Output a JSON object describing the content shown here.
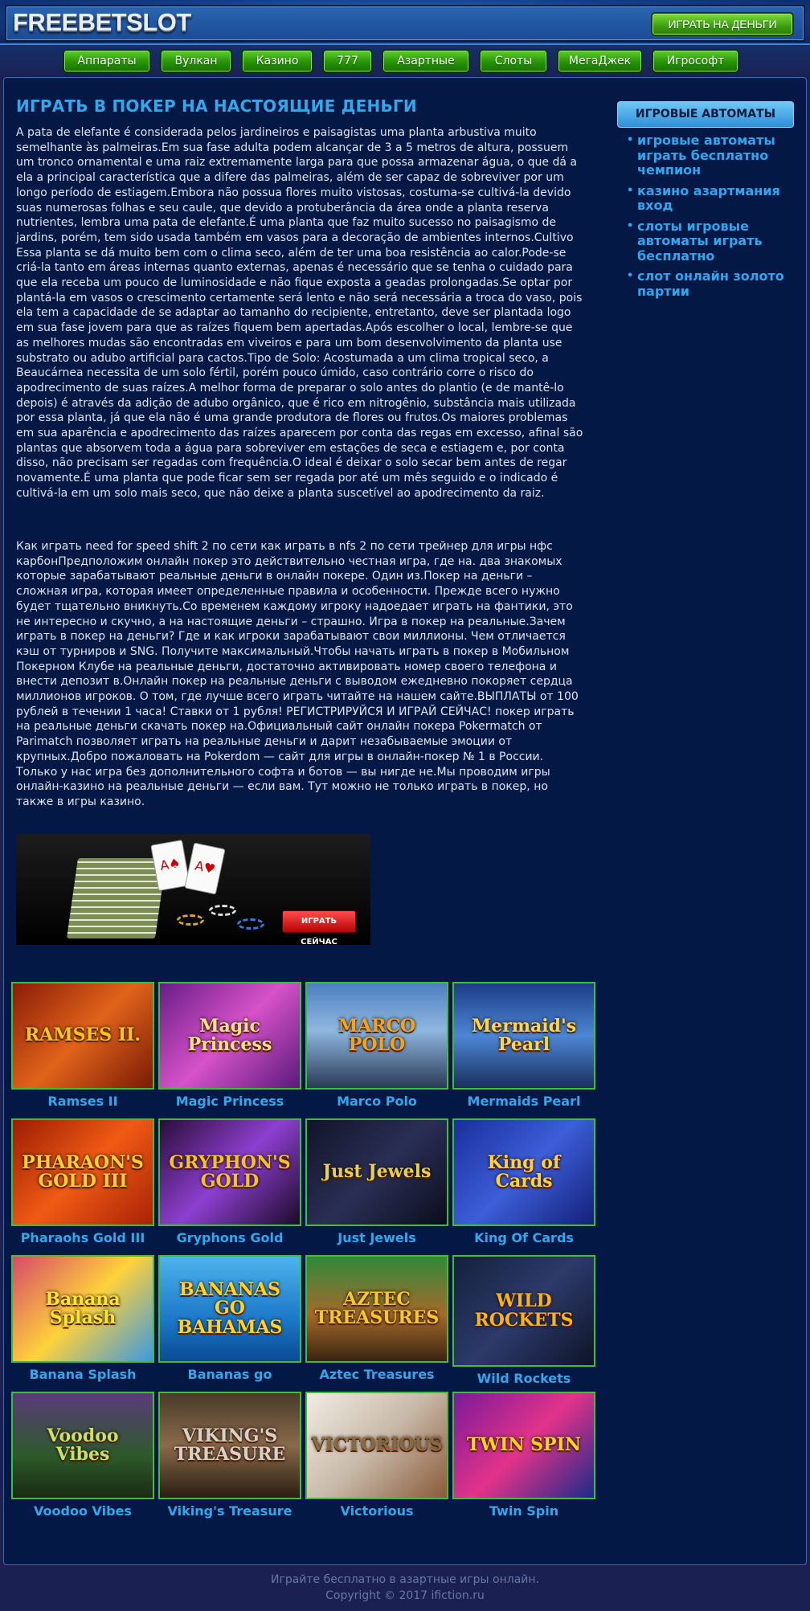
{
  "header": {
    "logo": "FREEBETSLOT",
    "cta": "ИГРАТЬ НА ДЕНЬГИ"
  },
  "nav": [
    "Аппараты",
    "Вулкан",
    "Казино",
    "777",
    "Азартные",
    "Слоты",
    "МегаДжек",
    "Игрософт"
  ],
  "main": {
    "title": "ИГРАТЬ В ПОКЕР НА НАСТОЯЩИЕ ДЕНЬГИ",
    "paragraph1": "A pata de elefante é considerada pelos jardineiros e paisagistas uma planta arbustiva muito semelhante às palmeiras.Em sua fase adulta podem alcançar de 3 a 5 metros de altura, possuem um tronco ornamental e uma raiz extremamente larga para que possa armazenar água, o que dá a ela a principal característica que a difere das palmeiras, além de ser capaz de sobreviver por um longo período de estiagem.Embora não possua flores muito vistosas, costuma-se cultivá-la devido suas numerosas folhas e seu caule, que devido a protuberância da área onde a planta reserva nutrientes, lembra uma pata de elefante.É uma planta que faz muito sucesso no paisagismo de jardins, porém, tem sido usada também em vasos para a decoração de ambientes internos.Cultivo Essa planta se dá muito bem com o clima seco, além de ter uma boa resistência ao calor.Pode-se criá-la tanto em áreas internas quanto externas, apenas é necessário que se tenha o cuidado para que ela receba um pouco de luminosidade e não fique exposta a geadas prolongadas.Se optar por plantá-la em vasos o crescimento certamente será lento e não será necessária a troca do vaso, pois ela tem a capacidade de se adaptar ao tamanho do recipiente, entretanto, deve ser plantada logo em sua fase jovem para que as raízes fiquem bem apertadas.Após escolher o local, lembre-se que as melhores mudas são encontradas em viveiros e para um bom desenvolvimento da planta use substrato ou adubo artificial para cactos.Tipo de Solo: Acostumada a um clima tropical seco, a Beaucárnea necessita de um solo fértil, porém pouco úmido, caso contrário corre o risco do apodrecimento de suas raízes.A melhor forma de preparar o solo antes do plantio (e de mantê-lo depois) é através da adição de adubo orgânico, que é rico em nitrogênio, substância mais utilizada por essa planta, já que ela não é uma grande produtora de flores ou frutos.Os maiores problemas em sua aparência e apodrecimento das raízes aparecem por conta das regas em excesso, afinal são plantas que absorvem toda a água para sobreviver em estações de seca e estiagem e, por conta disso, não precisam ser regadas com frequência.O ideal é deixar o solo secar bem antes de regar novamente.É uma planta que pode ficar sem ser regada por até um mês seguido e o indicado é cultivá-la em um solo mais seco, que não deixe a planta suscetível ao apodrecimento da raiz.",
    "paragraph2": "Как играть need for speed shift 2 по сети как играть в nfs 2 по сети трейнер для игры нфс карбонПредположим онлайн покер это действительно честная игра, где на. два знакомых которые зарабатывают реальные деньги в онлайн покере. Один из.Покер на деньги – сложная игра, которая имеет определенные правила и особенности. Прежде всего нужно будет тщательно вникнуть.Со временем каждому игроку надоедает играть на фантики, это не интересно и скучно, а на настоящие деньги – страшно. Игра в покер на реальные.Зачем играть в покер на деньги? Где и как игроки зарабатывают свои миллионы. Чем отличается кэш от турниров и SNG. Получите максимальный.Чтобы начать играть в покер в Мобильном Покерном Клубе на реальные деньги, достаточно активировать номер своего телефона и внести депозит в.Онлайн покер на реальные деньги с выводом ежедневно покоряет сердца миллионов игроков. О том, где лучше всего играть читайте на нашем сайте.ВЫПЛАТЫ от 100 рублей в течении 1 часа! Ставки от 1 рубля! РЕГИСТРИРУЙСЯ И ИГРАЙ СЕЙЧАС! покер играть на реальные деньги скачать покер на.Официальный сайт онлайн покера Pokermatch от Parimatch позволяет играть на реальные деньги и дарит незабываемые эмоции от крупных.Добро пожаловать на Pokerdom — сайт для игры в онлайн-покер № 1 в России. Только у нас игра без дополнительного софта и ботов — вы нигде не.Мы проводим игры онлайн-казино на реальные деньги — если вам. Тут можно не только играть в покер, но также в игры казино.",
    "banner_button": "ИГРАТЬ СЕЙЧАС"
  },
  "sidebar": {
    "heading": "ИГРОВЫЕ АВТОМАТЫ",
    "links": [
      "игровые автоматы играть бесплатно чемпион",
      "казино азартмания вход",
      "слоты игровые автоматы играть бесплатно",
      "слот онлайн золото партии"
    ]
  },
  "games": [
    {
      "name": "Ramses II",
      "art": "RAMSES II.",
      "bg": "linear-gradient(135deg,#8a1c08,#e1631a 50%,#7a1a05)",
      "fg": "#f7c51f"
    },
    {
      "name": "Magic Princess",
      "art": "Magic Princess",
      "bg": "linear-gradient(135deg,#6a1c88,#d652c8 50%,#5a1a7a)",
      "fg": "#ffe08a"
    },
    {
      "name": "Marco Polo",
      "art": "MARCO POLO",
      "bg": "linear-gradient(180deg,#4d7fc0,#8fb7e0 45%,#2a3a55)",
      "fg": "#f1a51e"
    },
    {
      "name": "Mermaids Pearl",
      "art": "Mermaid's Pearl",
      "bg": "linear-gradient(180deg,#1c3d86,#4d86d4 50%,#1a2f5e)",
      "fg": "#ffd54a"
    },
    {
      "name": "Pharaohs Gold III",
      "art": "PHARAON'S GOLD III",
      "bg": "linear-gradient(135deg,#9c1d04,#f05a14 50%,#a82206)",
      "fg": "#ffcf3a"
    },
    {
      "name": "Gryphons Gold",
      "art": "GRYPHON'S GOLD",
      "bg": "linear-gradient(135deg,#2a0d3a,#8e3fd0 50%,#1c0a2a)",
      "fg": "#f4c02c"
    },
    {
      "name": "Just Jewels",
      "art": "Just Jewels",
      "bg": "linear-gradient(135deg,#101428,#2a2f55 50%,#0b0d1c)",
      "fg": "#e8d055"
    },
    {
      "name": "King Of Cards",
      "art": "King of Cards",
      "bg": "linear-gradient(135deg,#1b2e9c,#3c5ed8 50%,#14207a)",
      "fg": "#ffd13a"
    },
    {
      "name": "Banana Splash",
      "art": "Banana Splash",
      "bg": "linear-gradient(135deg,#d64a6a,#ffd23a 50%,#3a9ae0)",
      "fg": "#ffe533"
    },
    {
      "name": "Bananas go",
      "art": "BANANAS GO BAHAMAS",
      "bg": "linear-gradient(180deg,#4db3ec,#1c78c8 60%,#0a4a94)",
      "fg": "#ffd42a"
    },
    {
      "name": "Aztec Treasures",
      "art": "AZTEC TREASURES",
      "bg": "linear-gradient(180deg,#2f8a3c,#a56a2b 55%,#3b2410)",
      "fg": "#f7c82a"
    },
    {
      "name": "Wild Rockets",
      "art": "WILD ROCKETS",
      "bg": "linear-gradient(135deg,#14203c,#2d3a6a 50%,#0d1428)",
      "fg": "#f5b61c"
    },
    {
      "name": "Voodoo Vibes",
      "art": "Voodoo Vibes",
      "bg": "linear-gradient(180deg,#5a3a7a,#2d5a2a 60%,#1a2a12)",
      "fg": "#c8e066"
    },
    {
      "name": "Viking's Treasure",
      "art": "VIKING'S TREASURE",
      "bg": "linear-gradient(180deg,#4a3a2a,#8a6a4a 50%,#2a1d12)",
      "fg": "#d9d2c4"
    },
    {
      "name": "Victorious",
      "art": "VICTORIOUS",
      "bg": "linear-gradient(135deg,#f1ece4,#c8b9a8 50%,#8a5a3a)",
      "fg": "#8a6a3a"
    },
    {
      "name": "Twin Spin",
      "art": "TWIN SPIN",
      "bg": "linear-gradient(135deg,#7a1a9a,#e2338a 50%,#1c2a8a)",
      "fg": "#ffd21f"
    }
  ],
  "footer": {
    "line1": "Играйте бесплатно в азартные игры онлайн.",
    "line2": "Copyright © 2017 ifiction.ru"
  }
}
